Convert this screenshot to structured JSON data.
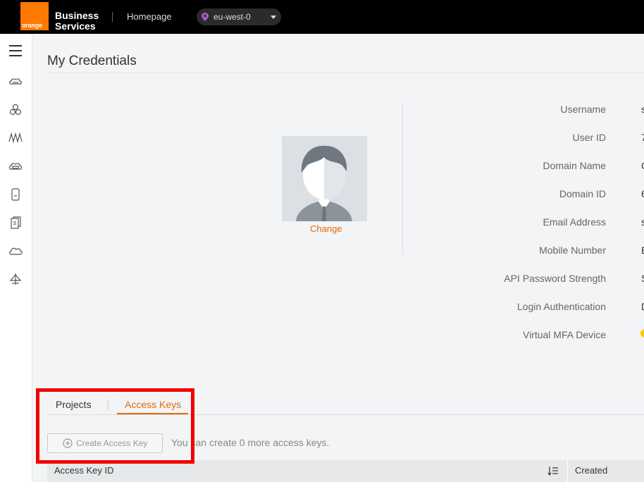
{
  "header": {
    "logo_text": "orange",
    "brand_line1": "Business",
    "brand_line2": "Services",
    "home_link": "Homepage",
    "region": "eu-west-0"
  },
  "sidebar": {
    "icons": [
      "menu-icon",
      "cloud-server-icon",
      "network-icon",
      "waveform-icon",
      "storage-icon",
      "mobile-device-icon",
      "document-copy-icon",
      "cloud-icon",
      "anchor-icon"
    ]
  },
  "page": {
    "title": "My Credentials"
  },
  "profile": {
    "change_label": "Change",
    "fields": [
      {
        "label": "Username",
        "value": "s"
      },
      {
        "label": "User ID",
        "value": "7"
      },
      {
        "label": "Domain Name",
        "value": "C"
      },
      {
        "label": "Domain ID",
        "value": "6"
      },
      {
        "label": "Email Address",
        "value": "s"
      },
      {
        "label": "Mobile Number",
        "value": "E"
      },
      {
        "label": "API Password Strength",
        "value": "S"
      },
      {
        "label": "Login Authentication",
        "value": "D"
      },
      {
        "label": "Virtual MFA Device",
        "value": ""
      }
    ]
  },
  "tabs": {
    "projects": "Projects",
    "access_keys": "Access Keys",
    "active": "Access Keys"
  },
  "access_keys": {
    "create_button": "Create Access Key",
    "hint": "You can create 0 more access keys.",
    "columns": [
      "Access Key ID",
      "Created"
    ]
  },
  "colors": {
    "accent": "#e4690a",
    "brand_orange": "#ff7900",
    "highlight": "#f20000"
  }
}
